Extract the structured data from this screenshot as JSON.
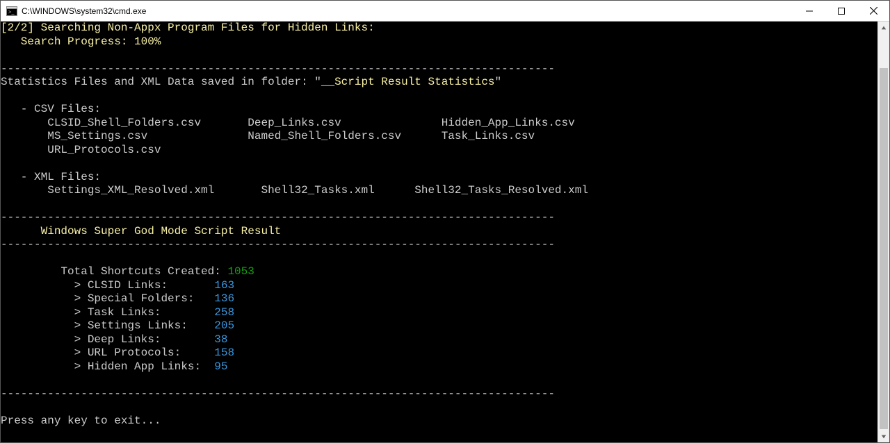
{
  "window": {
    "title": "C:\\WINDOWS\\system32\\cmd.exe"
  },
  "progress": {
    "line1": "[2/2] Searching Non-Appx Program Files for Hidden Links:",
    "line2": "   Search Progress: 100%"
  },
  "divider": "-----------------------------------------------------------------------------------",
  "stats": {
    "header_pre": "Statistics Files and XML Data saved in folder: \"",
    "folder": "__Script Result Statistics",
    "header_post": "\"",
    "csv_label": "   - CSV Files:",
    "csv_row1_a": "CLSID_Shell_Folders.csv",
    "csv_row1_b": "Deep_Links.csv",
    "csv_row1_c": "Hidden_App_Links.csv",
    "csv_row2_a": "MS_Settings.csv",
    "csv_row2_b": "Named_Shell_Folders.csv",
    "csv_row2_c": "Task_Links.csv",
    "csv_row3_a": "URL_Protocols.csv",
    "xml_label": "   - XML Files:",
    "xml_row1_a": "Settings_XML_Resolved.xml",
    "xml_row1_b": "Shell32_Tasks.xml",
    "xml_row1_c": "Shell32_Tasks_Resolved.xml"
  },
  "result": {
    "title": "      Windows Super God Mode Script Result",
    "total_label": "         Total Shortcuts Created: ",
    "total_value": "1053",
    "rows": [
      {
        "label": "           > CLSID Links:       ",
        "value": "163"
      },
      {
        "label": "           > Special Folders:   ",
        "value": "136"
      },
      {
        "label": "           > Task Links:        ",
        "value": "258"
      },
      {
        "label": "           > Settings Links:    ",
        "value": "205"
      },
      {
        "label": "           > Deep Links:        ",
        "value": "38"
      },
      {
        "label": "           > URL Protocols:     ",
        "value": "158"
      },
      {
        "label": "           > Hidden App Links:  ",
        "value": "95"
      }
    ]
  },
  "footer": "Press any key to exit..."
}
